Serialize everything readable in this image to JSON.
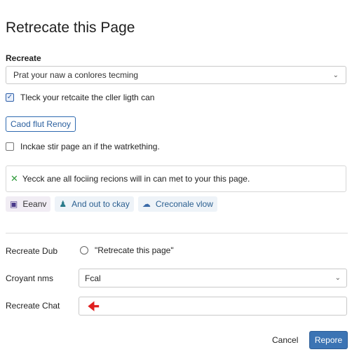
{
  "page": {
    "title": "Retrecate this Page"
  },
  "section": {
    "label": "Recreate"
  },
  "select": {
    "value": "Prat your naw a conlores tecming"
  },
  "checkbox1": {
    "checked": true,
    "label": "Tleck your retcaite the cller ligth can"
  },
  "outline_button": {
    "label": "Caod flut Renoy"
  },
  "checkbox2": {
    "checked": false,
    "label": "Inckae stir page an if the watrkething."
  },
  "notice": {
    "text": "Yecck ane all fociing recions will in can met to your this page."
  },
  "chips": [
    {
      "label": "Eeanv",
      "icon": "list-icon"
    },
    {
      "label": "And out to ckay",
      "icon": "person-icon"
    },
    {
      "label": "Creconale vlow",
      "icon": "cloud-icon"
    }
  ],
  "form": {
    "row1": {
      "label": "Recreate Dub",
      "option": "\"Retrecate this page\""
    },
    "row2": {
      "label": "Croyant nms",
      "value": "Fcal"
    },
    "row3": {
      "label": "Recreate Chat",
      "indicator": "arrow-left-icon"
    }
  },
  "footer": {
    "cancel": "Cancel",
    "primary": "Repore"
  },
  "colors": {
    "accent": "#3c74b4",
    "check": "#2e9a3a",
    "arrow": "#e02020"
  }
}
